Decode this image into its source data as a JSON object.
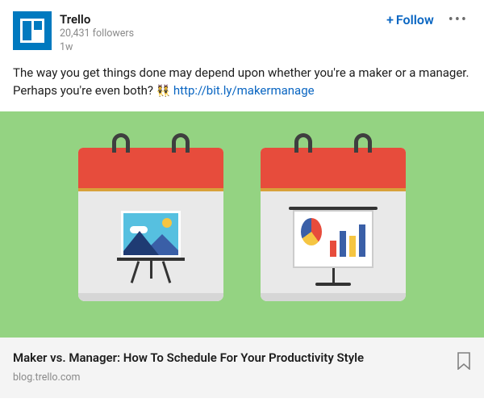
{
  "header": {
    "author": "Trello",
    "followers": "20,431 followers",
    "time": "1w",
    "follow_label": "Follow"
  },
  "post": {
    "text": "The way you get things done may depend upon whether you're a maker or a manager. Perhaps you're even both?",
    "emoji": "👯",
    "link": "http://bit.ly/makermanage"
  },
  "article": {
    "title": "Maker vs. Manager: How To Schedule For Your Productivity Style",
    "source": "blog.trello.com"
  }
}
